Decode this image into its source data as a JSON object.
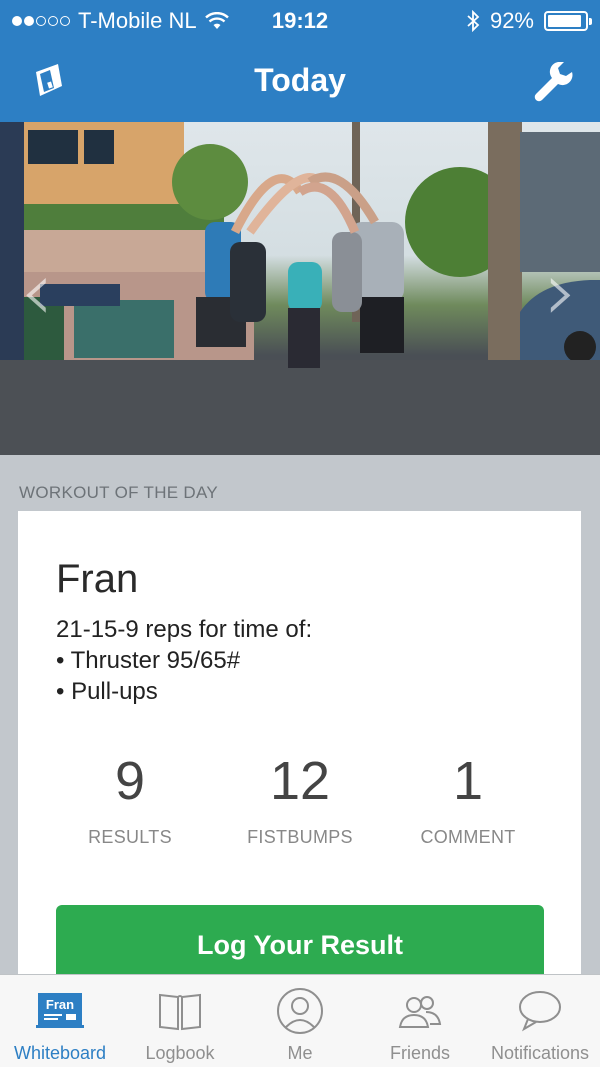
{
  "status_bar": {
    "carrier": "T-Mobile NL",
    "time": "19:12",
    "battery": "92%",
    "battery_level": 0.92
  },
  "nav": {
    "title": "Today"
  },
  "section": {
    "label": "WORKOUT OF THE DAY"
  },
  "workout": {
    "name": "Fran",
    "line1": "21-15-9 reps for time of:",
    "line2": "• Thruster 95/65#",
    "line3": "• Pull-ups"
  },
  "stats": [
    {
      "value": "9",
      "label": "RESULTS"
    },
    {
      "value": "12",
      "label": "FISTBUMPS"
    },
    {
      "value": "1",
      "label": "COMMENT"
    }
  ],
  "log_button": "Log Your Result",
  "tabs": [
    {
      "label": "Whiteboard",
      "icon": "whiteboard-icon",
      "icon_text": "Fran",
      "active": true
    },
    {
      "label": "Logbook",
      "icon": "book-icon"
    },
    {
      "label": "Me",
      "icon": "person-icon"
    },
    {
      "label": "Friends",
      "icon": "friends-icon"
    },
    {
      "label": "Notifications",
      "icon": "speech-bubble-icon"
    }
  ],
  "colors": {
    "brand_blue": "#2d7fc4",
    "button_green": "#2dab50",
    "background": "#c2c7cc"
  }
}
